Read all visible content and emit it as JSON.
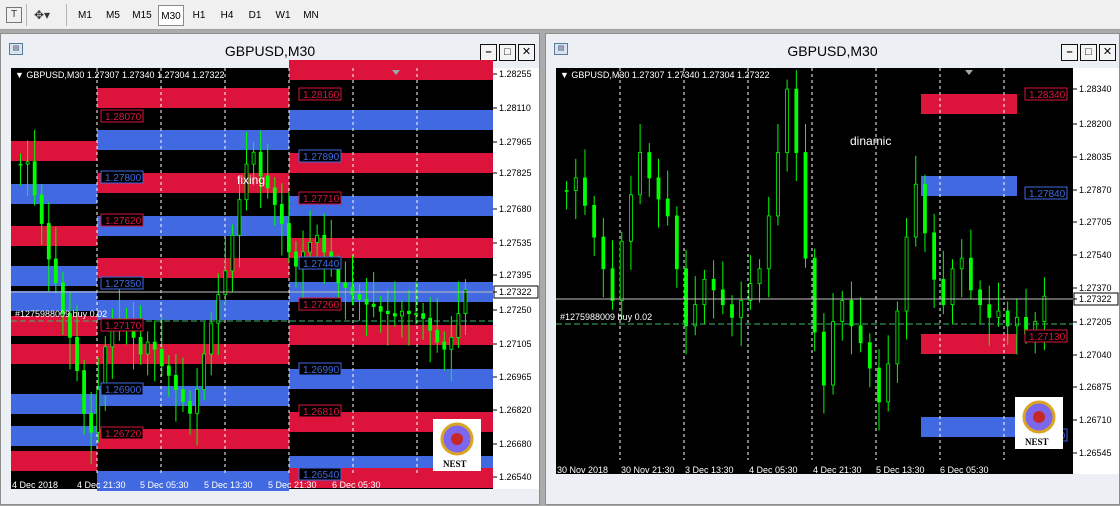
{
  "toolbar": {
    "timeframes": [
      "M1",
      "M5",
      "M15",
      "M30",
      "H1",
      "H4",
      "D1",
      "W1",
      "MN"
    ],
    "active": "M30"
  },
  "colors": {
    "bull": "#00ff00",
    "red": "#dc143c",
    "blue": "#4169e1",
    "bg": "#000000",
    "grid": "#ffffff"
  },
  "charts": [
    {
      "window_title": "GBPUSD,M30",
      "ohlc_header": "GBPUSD,M30  1.27307 1.27340 1.27304 1.27322",
      "order_label": "#1275988009 buy 0.02",
      "label": "fixing",
      "price_axis": [
        "1.28255",
        "1.28110",
        "1.27965",
        "1.27825",
        "1.27680",
        "1.27535",
        "1.27395",
        "1.27322",
        "1.27250",
        "1.27105",
        "1.26965",
        "1.26820",
        "1.26680",
        "1.26540"
      ],
      "current_price": "1.27322",
      "time_axis": [
        "4 Dec 2018",
        "4 Dec 21:30",
        "5 Dec 05:30",
        "5 Dec 13:30",
        "5 Dec 21:30",
        "6 Dec 05:30"
      ],
      "level_labels": [
        "1.28160",
        "1.28070",
        "1.27890",
        "1.27800",
        "1.27710",
        "1.27620",
        "1.27440",
        "1.27350",
        "1.27260",
        "1.27170",
        "1.26990",
        "1.26900",
        "1.26810",
        "1.26720",
        "1.26540"
      ],
      "logo_text": "NEST"
    },
    {
      "window_title": "GBPUSD,M30",
      "ohlc_header": "GBPUSD,M30  1.27307 1.27340 1.27304 1.27322",
      "order_label": "#1275988009 buy 0.02",
      "label": "dinamic",
      "price_axis": [
        "1.28340",
        "1.28200",
        "1.28035",
        "1.27870",
        "1.27705",
        "1.27540",
        "1.27370",
        "1.27322",
        "1.27205",
        "1.27040",
        "1.26875",
        "1.26710",
        "1.26545"
      ],
      "current_price": "1.27322",
      "time_axis": [
        "30 Nov 2018",
        "30 Nov 21:30",
        "3 Dec 13:30",
        "4 Dec 05:30",
        "4 Dec 21:30",
        "5 Dec 13:30",
        "6 Dec 05:30"
      ],
      "level_labels": [
        "1.28340",
        "1.27840",
        "1.27130",
        "1.26630"
      ],
      "logo_text": "NEST"
    }
  ],
  "chart_data": [
    {
      "type": "candlestick",
      "title": "GBPUSD,M30",
      "ylim": [
        1.2654,
        1.28255
      ],
      "series": [
        {
          "name": "GBPUSD",
          "close": [
            1.2785,
            1.2786,
            1.2772,
            1.276,
            1.2745,
            1.2735,
            1.2722,
            1.2712,
            1.2698,
            1.268,
            1.2672,
            1.269,
            1.2708,
            1.2715,
            1.272,
            1.2718,
            1.2712,
            1.2705,
            1.271,
            1.2707,
            1.27,
            1.2696,
            1.269,
            1.2685,
            1.268,
            1.269,
            1.2705,
            1.2718,
            1.273,
            1.274,
            1.2755,
            1.277,
            1.2785,
            1.279,
            1.278,
            1.2775,
            1.2768,
            1.276,
            1.2748,
            1.2742,
            1.2748,
            1.2752,
            1.2755,
            1.2748,
            1.2742,
            1.2735,
            1.2733,
            1.273,
            1.2728,
            1.2726,
            1.2725,
            1.2723,
            1.2722,
            1.2721,
            1.2723,
            1.2722,
            1.2722,
            1.272,
            1.2715,
            1.271,
            1.2707,
            1.2712,
            1.2722,
            1.2732
          ]
        }
      ],
      "levels": [
        1.2816,
        1.2807,
        1.2789,
        1.278,
        1.2771,
        1.2762,
        1.2744,
        1.2735,
        1.2726,
        1.2717,
        1.2699,
        1.269,
        1.2681,
        1.2672,
        1.2654
      ]
    },
    {
      "type": "candlestick",
      "title": "GBPUSD,M30",
      "ylim": [
        1.26545,
        1.284
      ],
      "series": [
        {
          "name": "GBPUSD",
          "close": [
            1.2782,
            1.2788,
            1.2775,
            1.276,
            1.2745,
            1.273,
            1.2758,
            1.278,
            1.28,
            1.2788,
            1.2778,
            1.277,
            1.2745,
            1.2718,
            1.2728,
            1.274,
            1.2735,
            1.2728,
            1.2722,
            1.273,
            1.2738,
            1.2745,
            1.277,
            1.28,
            1.283,
            1.28,
            1.275,
            1.2715,
            1.269,
            1.272,
            1.273,
            1.2718,
            1.271,
            1.2698,
            1.2682,
            1.27,
            1.2725,
            1.276,
            1.2785,
            1.2762,
            1.274,
            1.2728,
            1.2745,
            1.275,
            1.2735,
            1.2728,
            1.2722,
            1.2725,
            1.2718,
            1.2722,
            1.2714,
            1.272,
            1.2732
          ]
        }
      ],
      "levels": [
        1.2834,
        1.2784,
        1.2713,
        1.2663
      ]
    }
  ]
}
